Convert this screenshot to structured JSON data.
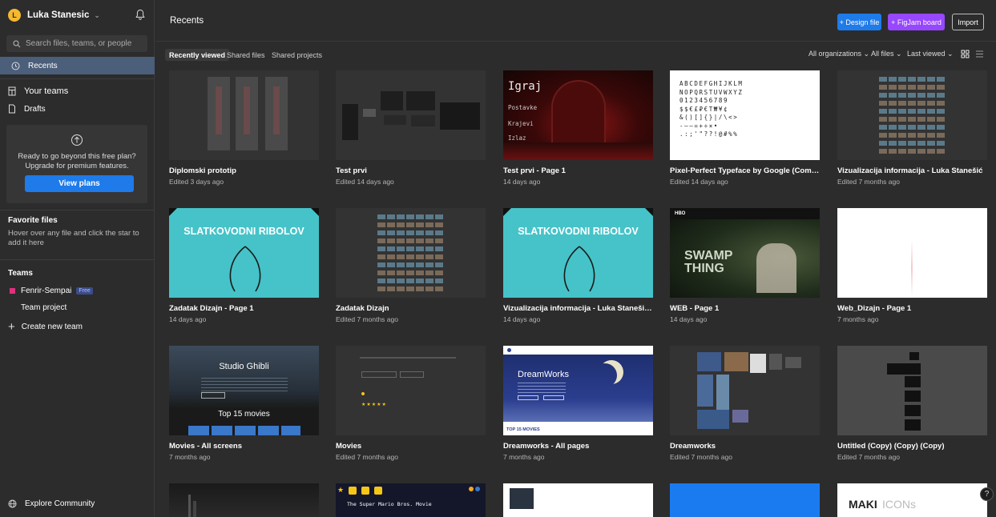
{
  "sidebar": {
    "user_initial": "L",
    "user_name": "Luka Stanesic",
    "search_placeholder": "Search files, teams, or people",
    "recents_label": "Recents",
    "your_teams_label": "Your teams",
    "drafts_label": "Drafts",
    "upgrade_text_1": "Ready to go beyond this free plan?",
    "upgrade_text_2": "Upgrade for premium features.",
    "view_plans_label": "View plans",
    "favorite_title": "Favorite files",
    "favorite_hint": "Hover over any file and click the star to add it here",
    "teams_title": "Teams",
    "team_name": "Fenrir-Sempai",
    "team_badge": "Free",
    "team_project_label": "Team project",
    "create_team_label": "Create new team",
    "explore_label": "Explore Community"
  },
  "header": {
    "title": "Recents",
    "design_file_label": "+ Design file",
    "figjam_label": "+ FigJam board",
    "import_label": "Import"
  },
  "filters": {
    "tabs": [
      "Recently viewed",
      "Shared files",
      "Shared projects"
    ],
    "all_orgs": "All organizations ⌄",
    "all_files": "All files ⌄",
    "last_viewed": "Last viewed ⌄"
  },
  "files": [
    {
      "name": "Diplomski prototip",
      "date": "Edited 3 days ago"
    },
    {
      "name": "Test prvi",
      "date": "Edited 14 days ago"
    },
    {
      "name": "Test prvi - Page 1",
      "date": "14 days ago"
    },
    {
      "name": "Pixel-Perfect Typeface by Google (Comm...",
      "date": "Edited 14 days ago"
    },
    {
      "name": "Vizualizacija informacija - Luka Stanešić",
      "date": "Edited 7 months ago"
    },
    {
      "name": "Zadatak Dizajn - Page 1",
      "date": "14 days ago"
    },
    {
      "name": "Zadatak Dizajn",
      "date": "Edited 7 months ago"
    },
    {
      "name": "Vizualizacija informacija - Luka Stanešić - ...",
      "date": "14 days ago"
    },
    {
      "name": "WEB - Page 1",
      "date": "14 days ago"
    },
    {
      "name": "Web_Dizajn - Page 1",
      "date": "7 months ago"
    },
    {
      "name": "Movies - All screens",
      "date": "7 months ago"
    },
    {
      "name": "Movies",
      "date": "Edited 7 months ago"
    },
    {
      "name": "Dreamworks - All pages",
      "date": "7 months ago"
    },
    {
      "name": "Dreamworks",
      "date": "Edited 7 months ago"
    },
    {
      "name": "Untitled (Copy) (Copy) (Copy)",
      "date": "Edited 7 months ago"
    }
  ],
  "thumbs": {
    "igraj": [
      "Igraj",
      "Postavke",
      "Krajevi",
      "Izlaz"
    ],
    "font_rows": [
      "ABCDEFGHIJKLM",
      "NOPQRSTUVWXYZ",
      "0123456789",
      "$$€£₽€T₩¥¢",
      "&()[]{}|/\\<>",
      "-–—=+÷×•",
      ".:;'\"??!@#%%"
    ],
    "slatkovodni": "SLATKOVODNI RIBOLOV",
    "swamp": "SWAMP THING",
    "ghibli": "Studio Ghibli",
    "top15": "Top 15 movies",
    "dreamworks": "DreamWorks",
    "dw_top": "TOP 15 MOVIES",
    "mario": "The Super Mario Bros. Movie",
    "maki": "MAKI",
    "maki2": "ICONs"
  },
  "help_label": "?",
  "colors": {
    "accent": "#1e7be9",
    "figjam": "#9747ff",
    "teal": "#45c3c8"
  }
}
